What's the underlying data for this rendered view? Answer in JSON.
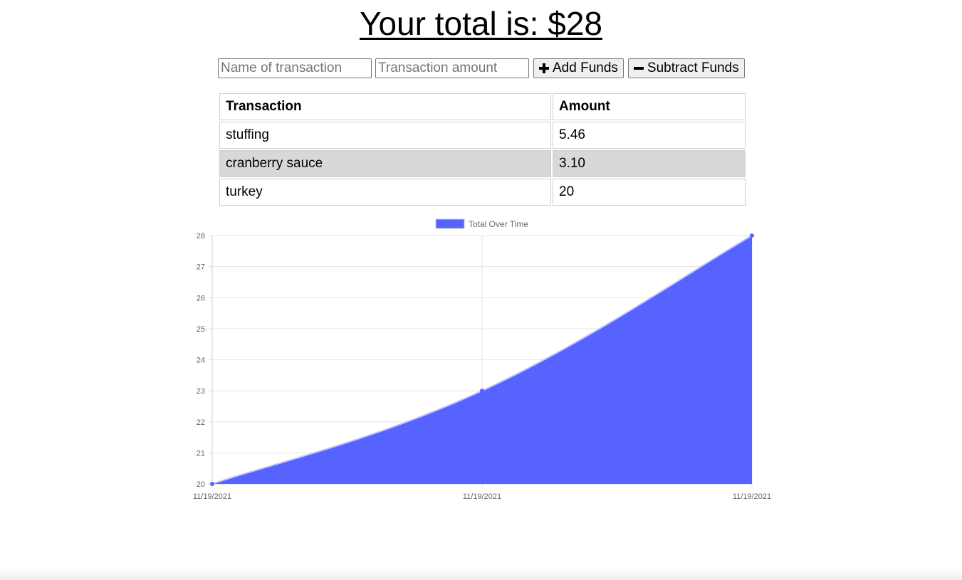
{
  "header": {
    "title": "Your total is: $28"
  },
  "form": {
    "name_placeholder": "Name of transaction",
    "amount_placeholder": "Transaction amount",
    "add_label": "Add Funds",
    "subtract_label": "Subtract Funds"
  },
  "table": {
    "columns": [
      "Transaction",
      "Amount"
    ],
    "rows": [
      {
        "name": "stuffing",
        "amount": "5.46"
      },
      {
        "name": "cranberry sauce",
        "amount": "3.10"
      },
      {
        "name": "turkey",
        "amount": "20"
      }
    ]
  },
  "chart_data": {
    "type": "area",
    "x": [
      "11/19/2021",
      "11/19/2021",
      "11/19/2021"
    ],
    "series": [
      {
        "name": "Total Over Time",
        "values": [
          20,
          23,
          28
        ],
        "color": "#5763ff"
      }
    ],
    "ylim": [
      20,
      28
    ],
    "yticks": [
      "20",
      "21",
      "22",
      "23",
      "24",
      "25",
      "26",
      "27",
      "28"
    ],
    "grid": true,
    "legend_placement": "top-center"
  }
}
